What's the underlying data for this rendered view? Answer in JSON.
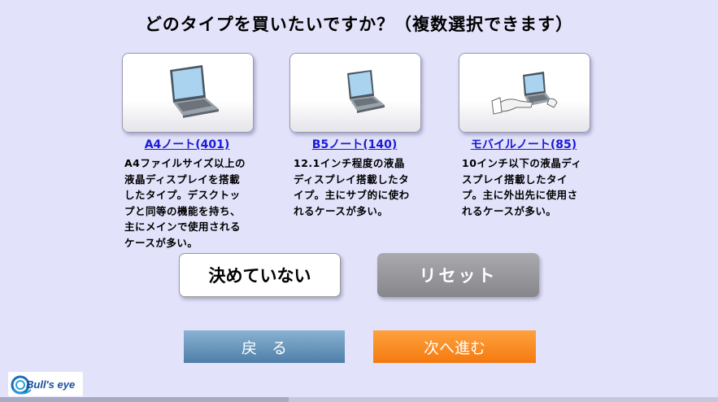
{
  "page": {
    "title": "どのタイプを買いたいですか？（複数選択できます）"
  },
  "options": [
    {
      "label": "A4ノート(401)",
      "description": "A4ファイルサイズ以上の\n液晶ディスプレイを搭載\nしたタイプ。デスクトッ\nプと同等の機能を持ち、\n主にメインで使用される\nケースが多い。",
      "image": "laptop-large-icon"
    },
    {
      "label": "B5ノート(140)",
      "description": "12.1インチ程度の液晶\nディスプレイ搭載したタ\nイプ。主にサブ的に使わ\nれるケースが多い。",
      "image": "laptop-medium-icon"
    },
    {
      "label": "モバイルノート(85)",
      "description": "10インチ以下の液晶ディ\nスプレイ搭載したタイ\nプ。主に外出先に使用さ\nれるケースが多い。",
      "image": "laptop-mobile-hand-icon"
    }
  ],
  "buttons": {
    "undecided": "決めていない",
    "reset": "リセット",
    "back": "戻る",
    "next": "次へ進む"
  },
  "logo": {
    "text": "Bull's eye"
  },
  "colors": {
    "background": "#e2e2fb",
    "link": "#1a1adb",
    "reset": "#96969b",
    "back": "#5f8db5",
    "next": "#f7881f"
  }
}
